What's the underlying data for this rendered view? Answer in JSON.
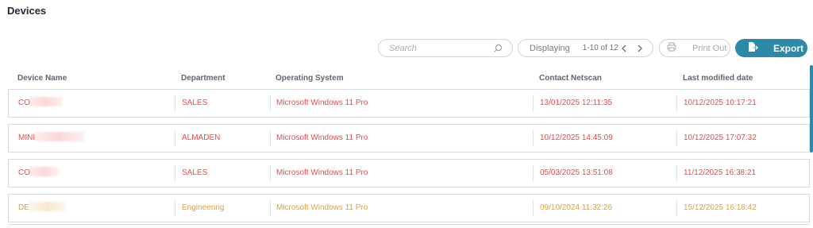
{
  "page": {
    "title": "Devices"
  },
  "toolbar": {
    "search_placeholder": "Search",
    "pager_label": "Displaying",
    "pager_range": "1-10 of 12",
    "print_label": "Print Out",
    "export_label": "Export",
    "accent_color": "#2b8aa8"
  },
  "table": {
    "columns": [
      "Device Name",
      "Department",
      "Operating System",
      "Contact Netscan",
      "Last modified date"
    ],
    "rows": [
      {
        "device": "CO",
        "department": "SALES",
        "os": "Microsoft Windows 11 Pro",
        "contact": "13/01/2025 12:11:35",
        "modified": "10/12/2025 10:17:21",
        "status_color": "#ee4a4a"
      },
      {
        "device": "MINI",
        "department": "ALMADEN",
        "os": "Microsoft Windows 11 Pro",
        "contact": "10/12/2025 14:45:09",
        "modified": "10/12/2025 17:07:32",
        "status_color": "#ee4a4a"
      },
      {
        "device": "CO",
        "department": "SALES",
        "os": "Microsoft Windows 11 Pro",
        "contact": "05/03/2025 13:51:08",
        "modified": "11/12/2025 16:38:21",
        "status_color": "#ee4a4a"
      },
      {
        "device": "DE",
        "department": "Engineering",
        "os": "Microsoft Windows 11 Pro",
        "contact": "09/10/2024 11:32:26",
        "modified": "15/12/2025 16:18:42",
        "status_color": "#e5a13a"
      }
    ]
  },
  "icons": [
    "search-icon",
    "chevron-left-icon",
    "chevron-right-icon",
    "printer-icon",
    "export-icon"
  ]
}
